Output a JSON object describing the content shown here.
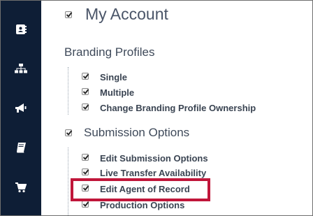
{
  "page": {
    "title": "My Account",
    "sections": [
      {
        "label": "Branding Profiles",
        "items": [
          "Single",
          "Multiple",
          "Change Branding Profile Ownership"
        ]
      },
      {
        "label": "Submission Options",
        "items": [
          "Edit Submission Options",
          "Live Transfer Availability",
          "Edit Agent of Record",
          "Production Options"
        ]
      }
    ]
  },
  "sidebar": {
    "icons": [
      "contacts-icon",
      "org-chart-icon",
      "megaphone-icon",
      "book-icon",
      "cart-icon"
    ]
  },
  "colors": {
    "sidebar_bg": "#0e1e36",
    "highlight": "#c0163a"
  }
}
